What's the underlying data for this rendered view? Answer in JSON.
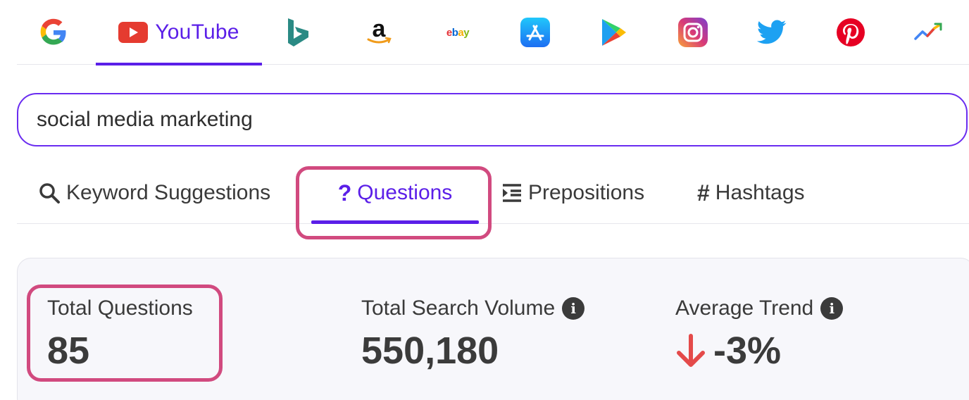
{
  "platforms": {
    "items": [
      {
        "name": "google",
        "label": ""
      },
      {
        "name": "youtube",
        "label": "YouTube",
        "active": true
      },
      {
        "name": "bing",
        "label": ""
      },
      {
        "name": "amazon",
        "label": ""
      },
      {
        "name": "ebay",
        "label": "ebay"
      },
      {
        "name": "app-store",
        "label": ""
      },
      {
        "name": "play-store",
        "label": ""
      },
      {
        "name": "instagram",
        "label": ""
      },
      {
        "name": "twitter",
        "label": ""
      },
      {
        "name": "pinterest",
        "label": ""
      },
      {
        "name": "trends",
        "label": ""
      }
    ]
  },
  "search": {
    "value": "social media marketing"
  },
  "modes": {
    "keyword_suggestions": "Keyword Suggestions",
    "questions": "Questions",
    "prepositions": "Prepositions",
    "hashtags": "Hashtags",
    "active": "questions"
  },
  "stats": {
    "total_questions_label": "Total Questions",
    "total_questions_value": "85",
    "total_search_volume_label": "Total Search Volume",
    "total_search_volume_value": "550,180",
    "average_trend_label": "Average Trend",
    "average_trend_value": "-3%"
  },
  "colors": {
    "accent": "#5b1fe8",
    "highlight": "#d14a7f",
    "trend_down": "#e44a4a"
  }
}
